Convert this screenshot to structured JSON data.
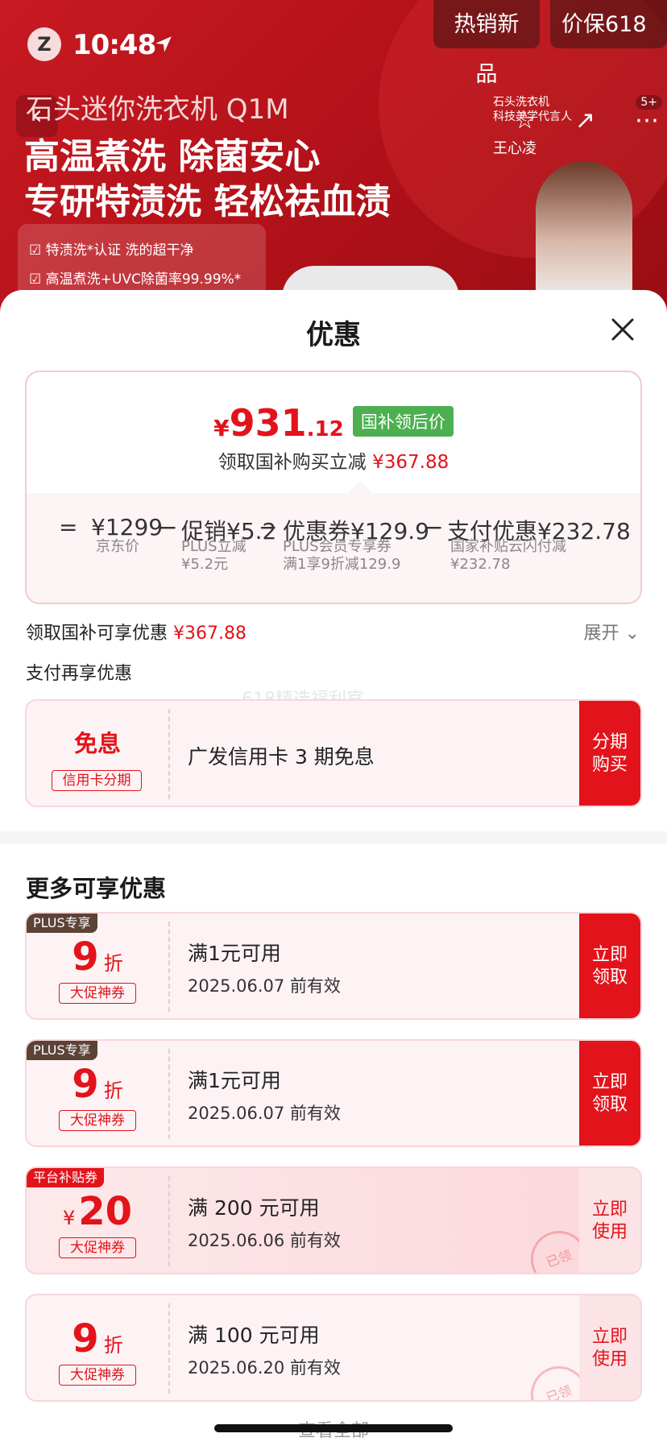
{
  "status": {
    "time": "10:48"
  },
  "banner": {
    "logo": "Z",
    "hot_new": "热销新品",
    "price_protect": "价保618",
    "subtitle": "石头迷你洗衣机 Q1M",
    "headline1": "高温煮洗 除菌安心",
    "headline2": "专研特渍洗 轻松祛血渍",
    "check1": "特渍洗*认证 洗的超干净",
    "check2": "高温煮洗+UVC除菌率99.99%*",
    "spokes_line1": "石头洗衣机",
    "spokes_line2": "科技美学代言人",
    "spokes_name": "王心凌",
    "share_count": "5+"
  },
  "sheet": {
    "title": "优惠",
    "price_card": {
      "yen": "¥",
      "price_int": "931",
      "price_dec": ".12",
      "tag": "国补领后价",
      "sub_label": "领取国补购买立减",
      "sub_amount": "¥367.88",
      "calc": [
        {
          "op": "=",
          "value": "¥1299",
          "label": "京东价",
          "label2": ""
        },
        {
          "op": "−",
          "value": "促销¥5.2",
          "label": "PLUS立减",
          "label2": "¥5.2元"
        },
        {
          "op": "−",
          "value": "优惠券¥129.9",
          "label": "PLUS会员专享券",
          "label2": "满1享9折减129.9"
        },
        {
          "op": "−",
          "value": "支付优惠¥232.78",
          "label": "国家补贴云闪付减",
          "label2": "¥232.78"
        }
      ]
    },
    "gov_row": {
      "label": "领取国补可享优惠",
      "amount": "¥367.88",
      "expand": "展开"
    },
    "pay_row": "支付再享优惠",
    "watermark": "618精选福利官",
    "installment": {
      "big": "免息",
      "tag": "信用卡分期",
      "title": "广发信用卡 3 期免息",
      "button": "分期购买"
    },
    "more_title": "更多可享优惠",
    "coupons": [
      {
        "corner": "PLUS专享",
        "num": "9",
        "unit": "折",
        "tag": "大促神券",
        "title": "满1元可用",
        "date": "2025.06.07 前有效",
        "button": "立即领取",
        "style": "red"
      },
      {
        "corner": "PLUS专享",
        "num": "9",
        "unit": "折",
        "tag": "大促神券",
        "title": "满1元可用",
        "date": "2025.06.07 前有效",
        "button": "立即领取",
        "style": "red"
      },
      {
        "corner": "平台补贴券",
        "num": "20",
        "unit": "¥",
        "tag": "大促神券",
        "title": "满 200 元可用",
        "date": "2025.06.06 前有效",
        "button": "立即使用",
        "style": "soft",
        "stamp": "已领"
      },
      {
        "corner": "",
        "num": "9",
        "unit": "折",
        "tag": "大促神券",
        "title": "满 100 元可用",
        "date": "2025.06.20 前有效",
        "button": "立即使用",
        "style": "soft",
        "stamp": "已领"
      }
    ],
    "view_all": "查看全部"
  },
  "colors": {
    "accent": "#e3131b",
    "gov_tag": "#4caf50",
    "plus": "#5b4336"
  }
}
